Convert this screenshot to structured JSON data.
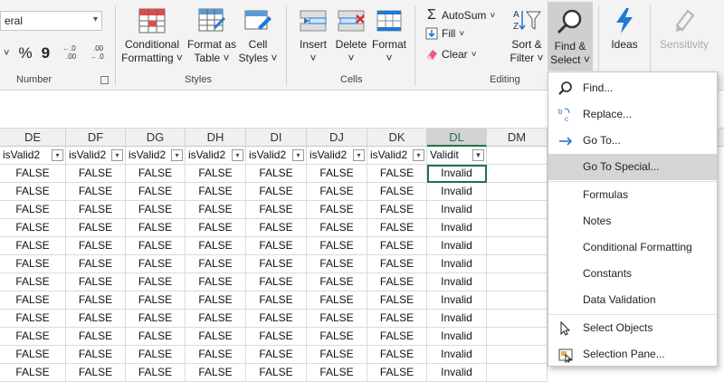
{
  "ribbon": {
    "number_format_value": "eral",
    "number_symbols": [
      "%",
      "9"
    ],
    "groups": {
      "number": "Number",
      "styles": "Styles",
      "cells": "Cells",
      "editing": "Editing"
    },
    "styles": {
      "conditional_l1": "Conditional",
      "conditional_l2": "Formatting ˅",
      "format_table_l1": "Format as",
      "format_table_l2": "Table ˅",
      "cell_styles_l1": "Cell",
      "cell_styles_l2": "Styles ˅"
    },
    "cells": {
      "insert": "Insert",
      "delete": "Delete",
      "format": "Format",
      "chev": "˅"
    },
    "editing": {
      "autosum": "AutoSum",
      "fill": "Fill",
      "clear": "Clear",
      "sort_l1": "Sort &",
      "sort_l2": "Filter ˅",
      "find_l1": "Find &",
      "find_l2": "Select ˅"
    },
    "ideas": "Ideas",
    "sensitivity": "Sensitivity"
  },
  "grid": {
    "columns": [
      "DE",
      "DF",
      "DG",
      "DH",
      "DI",
      "DJ",
      "DK",
      "DL",
      "DM"
    ],
    "filter_headers": [
      "isValid2",
      "isValid2",
      "isValid2",
      "isValid2",
      "isValid2",
      "isValid2",
      "isValid2",
      "Validit"
    ],
    "cell_false": "FALSE",
    "cell_invalid": "Invalid"
  },
  "menu": {
    "items": [
      {
        "label": "Find...",
        "icon": "search-icon"
      },
      {
        "label": "Replace...",
        "icon": "replace-icon"
      },
      {
        "label": "Go To...",
        "icon": "arrow-right-icon"
      },
      {
        "label": "Go To Special...",
        "icon": "none"
      },
      {
        "label": "Formulas",
        "icon": "none"
      },
      {
        "label": "Notes",
        "icon": "none"
      },
      {
        "label": "Conditional Formatting",
        "icon": "none"
      },
      {
        "label": "Constants",
        "icon": "none"
      },
      {
        "label": "Data Validation",
        "icon": "none"
      },
      {
        "label": "Select Objects",
        "icon": "pointer-icon"
      },
      {
        "label": "Selection Pane...",
        "icon": "selection-pane-icon"
      }
    ],
    "highlighted_index": 3
  },
  "colors": {
    "excel_green": "#217346",
    "accent_blue": "#1e78d6",
    "menu_highlight": "#d5d5d5"
  }
}
